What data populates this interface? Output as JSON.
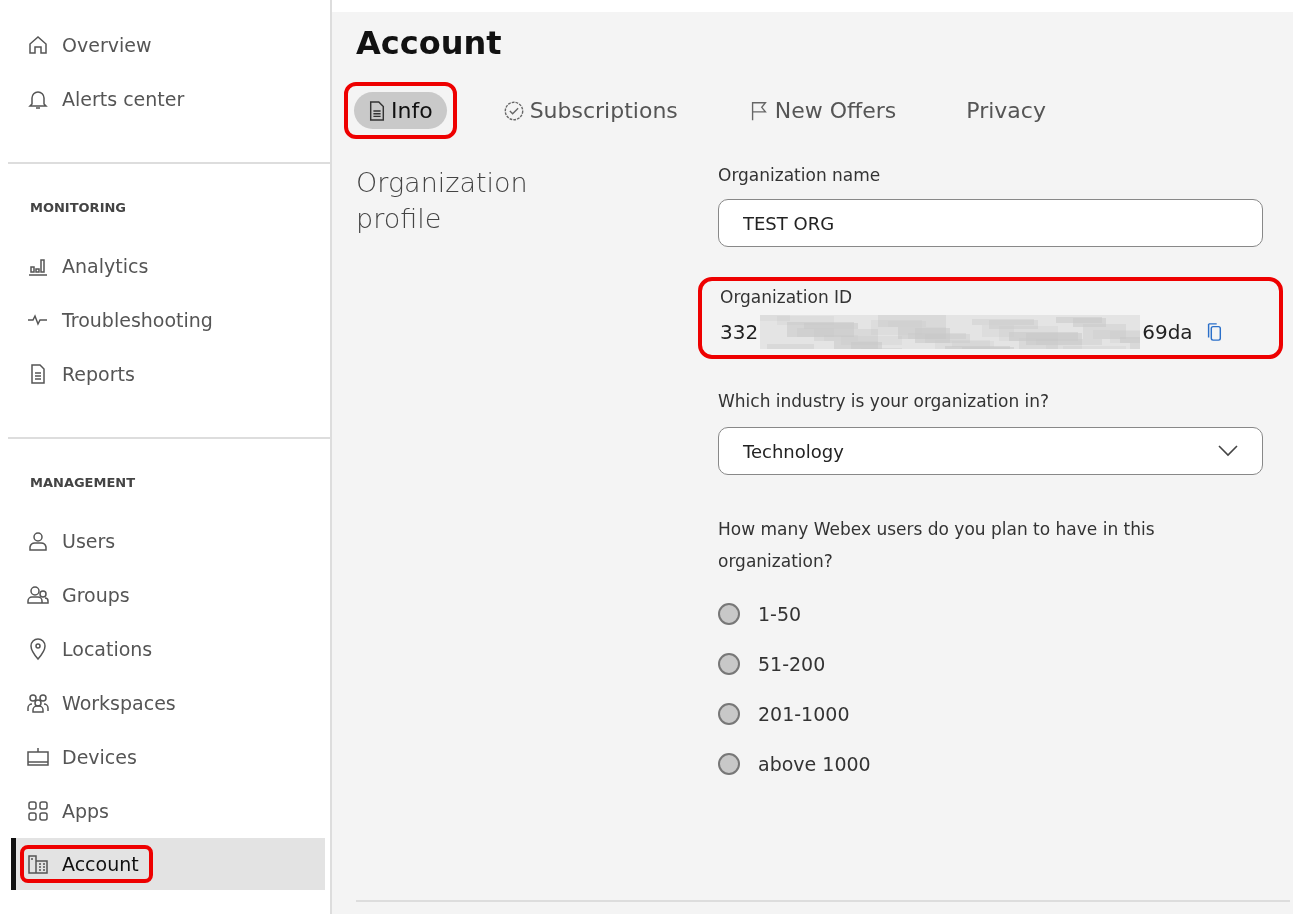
{
  "sidebar": {
    "top_items": [
      {
        "label": "Overview",
        "selected": false
      },
      {
        "label": "Alerts center",
        "selected": false
      }
    ],
    "sections": [
      {
        "heading": "MONITORING",
        "items": [
          {
            "label": "Analytics",
            "selected": false
          },
          {
            "label": "Troubleshooting",
            "selected": false
          },
          {
            "label": "Reports",
            "selected": false
          }
        ]
      },
      {
        "heading": "MANAGEMENT",
        "items": [
          {
            "label": "Users",
            "selected": false
          },
          {
            "label": "Groups",
            "selected": false
          },
          {
            "label": "Locations",
            "selected": false
          },
          {
            "label": "Workspaces",
            "selected": false
          },
          {
            "label": "Devices",
            "selected": false
          },
          {
            "label": "Apps",
            "selected": false
          },
          {
            "label": "Account",
            "selected": true,
            "highlighted": true
          }
        ]
      }
    ]
  },
  "page": {
    "title": "Account",
    "tabs": [
      {
        "label": "Info",
        "selected": true,
        "highlighted": true
      },
      {
        "label": "Subscriptions",
        "selected": false,
        "highlighted": false
      },
      {
        "label": "New Offers",
        "selected": false,
        "highlighted": false
      },
      {
        "label": "Privacy",
        "selected": false,
        "highlighted": false
      }
    ],
    "section_title": "Organization profile",
    "org_name": {
      "label": "Organization name",
      "value": "TEST ORG"
    },
    "org_id": {
      "label": "Organization ID",
      "value_start": "332",
      "value_end": "69da",
      "redacted": true,
      "highlighted": true
    },
    "industry": {
      "label": "Which industry is your organization in?",
      "value": "Technology"
    },
    "users": {
      "question": "How many Webex users do you plan to have in this organization?",
      "options": [
        {
          "label": "1-50",
          "selected": false
        },
        {
          "label": "51-200",
          "selected": false
        },
        {
          "label": "201-1000",
          "selected": false
        },
        {
          "label": "above 1000",
          "selected": false
        }
      ]
    }
  }
}
